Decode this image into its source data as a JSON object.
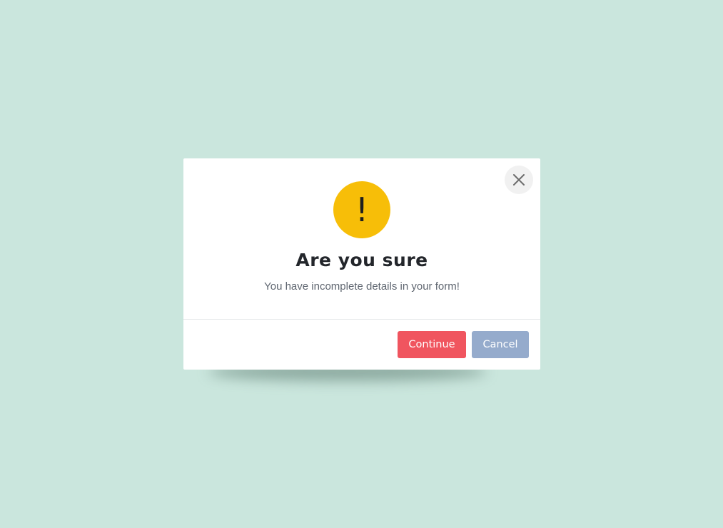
{
  "dialog": {
    "title": "Are you sure",
    "message": "You have incomplete details in your form!",
    "warning_symbol": "!",
    "warning_icon": "exclamation-icon",
    "close_icon": "close-icon",
    "buttons": {
      "continue_label": "Continue",
      "cancel_label": "Cancel"
    }
  },
  "colors": {
    "background": "#cae6dd",
    "modal": "#ffffff",
    "warning": "#f7be08",
    "continue": "#f0555f",
    "cancel": "#95abcc",
    "title": "#23262b",
    "message": "#5f6670"
  }
}
